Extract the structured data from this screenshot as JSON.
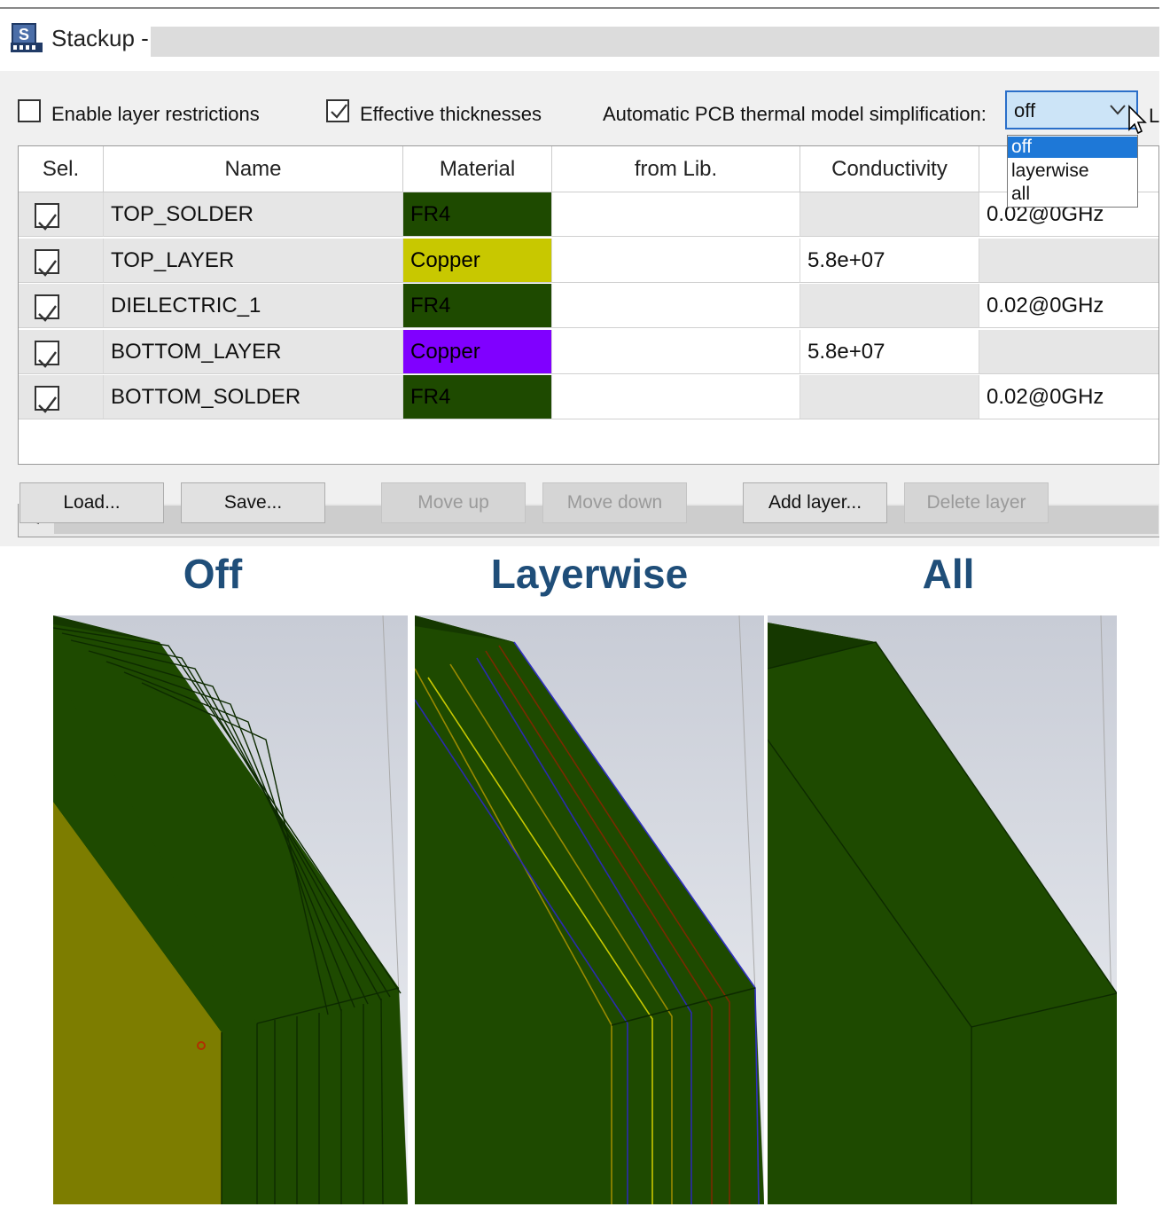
{
  "window": {
    "title": "Stackup -"
  },
  "options": {
    "enable_layer_restrictions": {
      "label": "Enable layer restrictions",
      "checked": false
    },
    "effective_thicknesses": {
      "label": "Effective thicknesses",
      "checked": true
    },
    "simplification_label": "Automatic PCB thermal model simplification:",
    "simplification_value": "off",
    "simplification_options": [
      "off",
      "layerwise",
      "all"
    ],
    "cut_off_next_label": "L"
  },
  "table": {
    "headers": [
      "Sel.",
      "Name",
      "Material",
      "from Lib.",
      "Conductivity"
    ],
    "rows": [
      {
        "selected": true,
        "name": "TOP_SOLDER",
        "material": "FR4",
        "material_color": "#1e4a00",
        "from_lib": "",
        "conductivity": "",
        "extra": "0.02@0GHz"
      },
      {
        "selected": true,
        "name": "TOP_LAYER",
        "material": "Copper",
        "material_color": "#c8c800",
        "from_lib": "",
        "conductivity": "5.8e+07",
        "extra": ""
      },
      {
        "selected": true,
        "name": "DIELECTRIC_1",
        "material": "FR4",
        "material_color": "#1e4a00",
        "from_lib": "",
        "conductivity": "",
        "extra": "0.02@0GHz"
      },
      {
        "selected": true,
        "name": "BOTTOM_LAYER",
        "material": "Copper",
        "material_color": "#8000ff",
        "from_lib": "",
        "conductivity": "5.8e+07",
        "extra": ""
      },
      {
        "selected": true,
        "name": "BOTTOM_SOLDER",
        "material": "FR4",
        "material_color": "#1e4a00",
        "from_lib": "",
        "conductivity": "",
        "extra": "0.02@0GHz"
      }
    ]
  },
  "buttons": {
    "load": "Load...",
    "save": "Save...",
    "move_up": "Move up",
    "move_down": "Move down",
    "add_layer": "Add layer...",
    "delete_layer": "Delete layer"
  },
  "comparison": {
    "captions": [
      "Off",
      "Layerwise",
      "All"
    ]
  },
  "colors": {
    "caption": "#1f4e79",
    "board_green": "#1e4a00",
    "copper_yellow": "#7d7d00",
    "selection_blue": "#1e78d7"
  }
}
